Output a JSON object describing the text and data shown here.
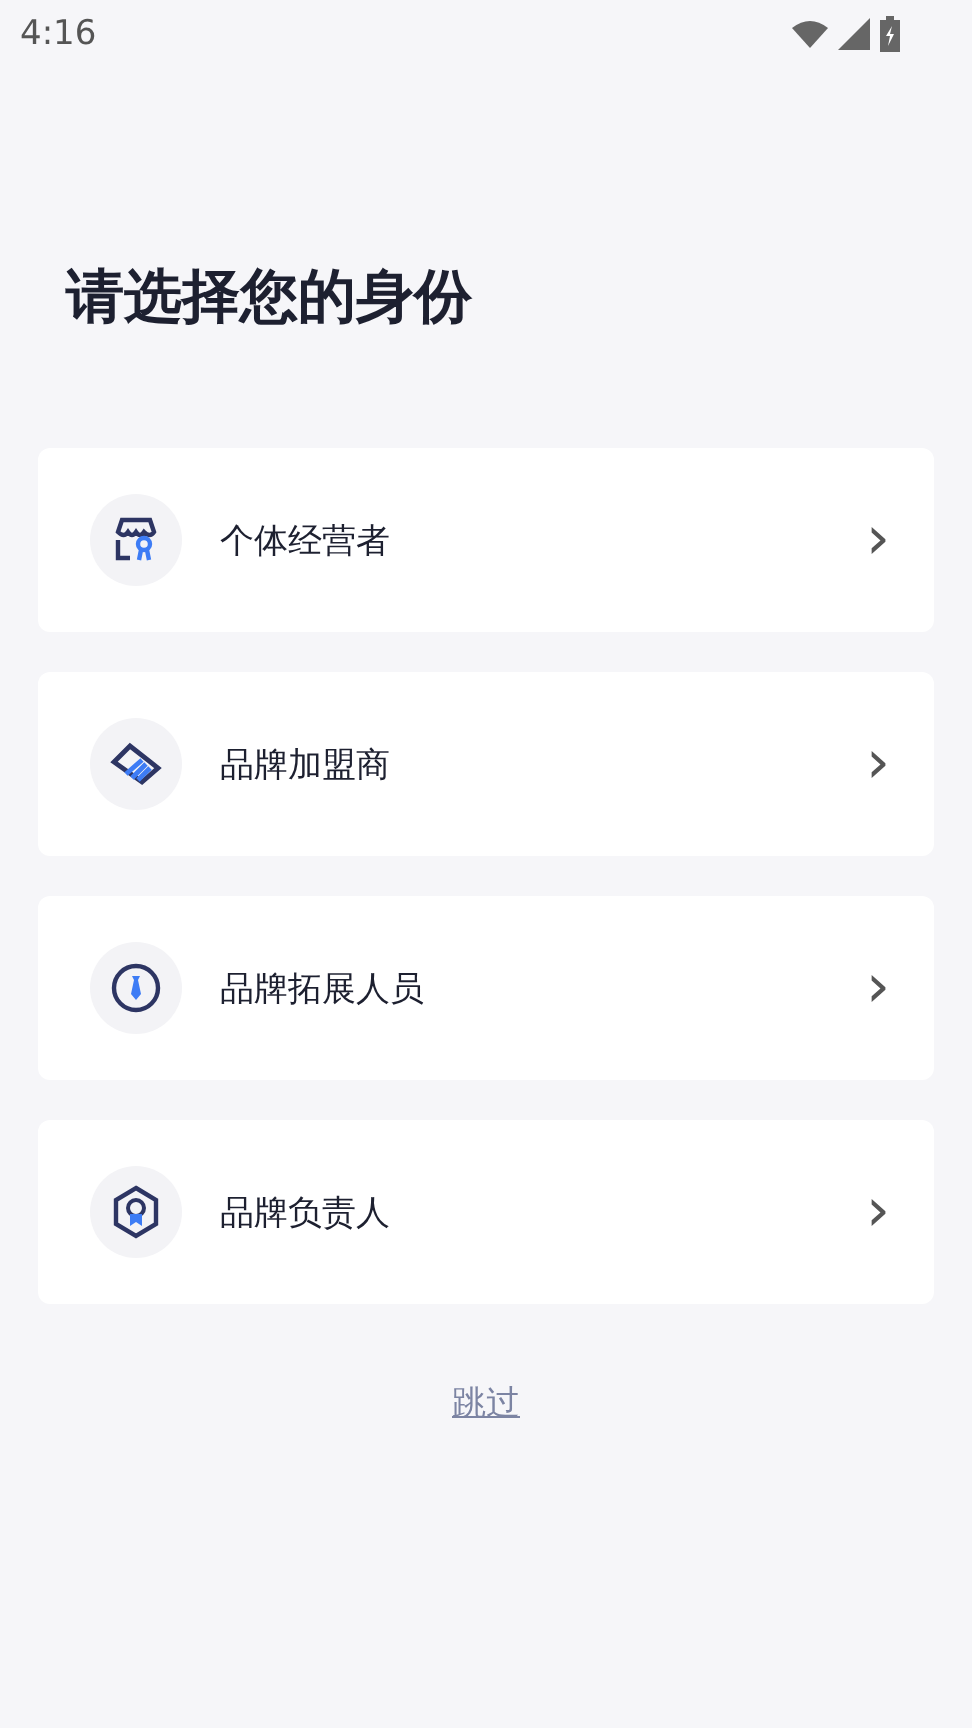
{
  "status_bar": {
    "time": "4:16"
  },
  "title": "请选择您的身份",
  "options": [
    {
      "kind": "shop",
      "label": "个体经营者",
      "chevron": "›"
    },
    {
      "kind": "handshake",
      "label": "品牌加盟商",
      "chevron": "›"
    },
    {
      "kind": "tie",
      "label": "品牌拓展人员",
      "chevron": "›"
    },
    {
      "kind": "badge",
      "label": "品牌负责人",
      "chevron": "›"
    }
  ],
  "skip_link": "跳过"
}
